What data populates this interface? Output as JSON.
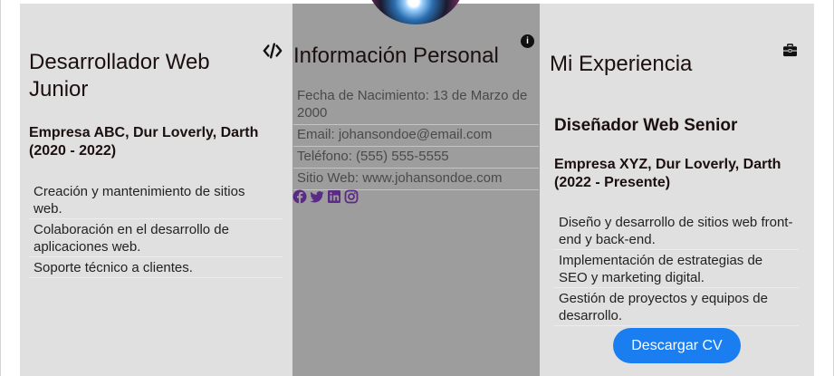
{
  "left": {
    "title": "Desarrollador Web Junior",
    "company": "Empresa ABC, Dur Loverly, Darth (2020 - 2022)",
    "items": [
      "Creación y mantenimiento de sitios web.",
      "Colaboración en el desarrollo de aplicaciones web.",
      "Soporte técnico a clientes."
    ],
    "icon": "code-icon"
  },
  "middle": {
    "title": "Información Personal",
    "info_icon_glyph": "i",
    "info": [
      "Fecha de Nacimiento: 13 de Marzo de 2000",
      "Email: johansondoe@email.com",
      "Teléfono: (555) 555-5555",
      "Sitio Web: www.johansondoe.com"
    ],
    "social_icons": [
      "facebook-icon",
      "twitter-icon",
      "linkedin-icon",
      "instagram-icon"
    ],
    "social_color": "#5b2a86"
  },
  "right": {
    "title": "Mi Experiencia",
    "job": "Diseñador Web Senior",
    "company": "Empresa XYZ, Dur Loverly, Darth (2022 - Presente)",
    "items": [
      "Diseño y desarrollo de sitios web front-end y back-end.",
      "Implementación de estrategias de SEO y marketing digital.",
      "Gestión de proyectos y equipos de desarrollo."
    ],
    "icon": "briefcase-icon",
    "button_label": "Descargar CV",
    "button_color": "#1a7df0"
  }
}
